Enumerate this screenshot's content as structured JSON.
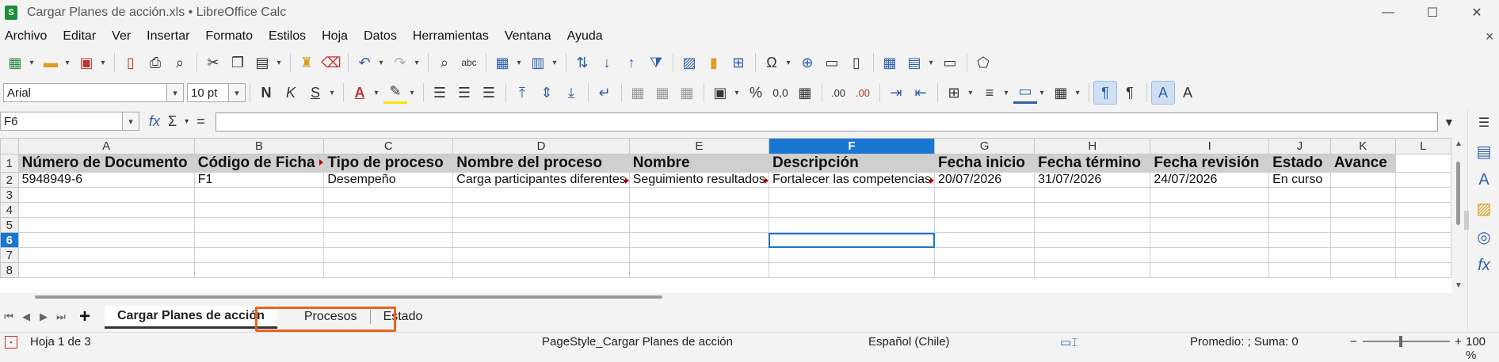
{
  "window": {
    "title": "Cargar Planes de acción.xls • LibreOffice Calc",
    "app_icon_letter": "S",
    "controls": {
      "minimize": "—",
      "maximize": "☐",
      "close": "✕"
    }
  },
  "menu": [
    "Archivo",
    "Editar",
    "Ver",
    "Insertar",
    "Formato",
    "Estilos",
    "Hoja",
    "Datos",
    "Herramientas",
    "Ventana",
    "Ayuda"
  ],
  "menu_close_icon": "✕",
  "formatting": {
    "font_name": "Arial",
    "font_size": "10 pt",
    "bold": "N",
    "italic": "K",
    "underline": "S",
    "font_color_glyph": "A",
    "percent": "%",
    "decimal": "0,0",
    "add_decimal": ".00",
    "del_decimal": ".00"
  },
  "formula_bar": {
    "cell_ref": "F6",
    "fx_glyph": "fx",
    "sum_glyph": "Σ",
    "equals_glyph": "=",
    "expand_glyph": "▼"
  },
  "spreadsheet": {
    "columns": [
      "A",
      "B",
      "C",
      "D",
      "E",
      "F",
      "G",
      "H",
      "I",
      "J",
      "K",
      "L"
    ],
    "selected_column": "F",
    "rows": [
      "1",
      "2",
      "3",
      "4",
      "5",
      "6",
      "7",
      "8"
    ],
    "selected_row": "6",
    "header_row": [
      "Número de Documento",
      "Código de Ficha",
      "Tipo de proceso",
      "Nombre del proceso",
      "Nombre",
      "Descripción",
      "Fecha inicio",
      "Fecha término",
      "Fecha revisión",
      "Estado",
      "Avance",
      ""
    ],
    "data_row": [
      "5948949-6",
      "F1",
      "Desempeño",
      "Carga participantes diferentes",
      "Seguimiento resultados",
      "Fortalecer las competencias",
      "20/07/2026",
      "31/07/2026",
      "24/07/2026",
      "En curso",
      "",
      ""
    ]
  },
  "sheet_tabs": {
    "nav": [
      "⏮",
      "◀",
      "▶",
      "⏭"
    ],
    "add": "+",
    "tabs": [
      "Cargar Planes de acción",
      "Procesos",
      "Estado"
    ],
    "active_index": 0,
    "highlight_color": "#e8641b"
  },
  "status": {
    "sheet": "Hoja 1 de 3",
    "page_style": "PageStyle_Cargar Planes de acción",
    "language": "Español (Chile)",
    "summary": "Promedio: ; Suma: 0",
    "zoom_minus": "−",
    "zoom_plus": "+",
    "zoom": "100 %"
  },
  "colors": {
    "selection": "#1976d2",
    "header_fill": "#cfcfcf",
    "overflow_arrow": "#bb0000"
  }
}
